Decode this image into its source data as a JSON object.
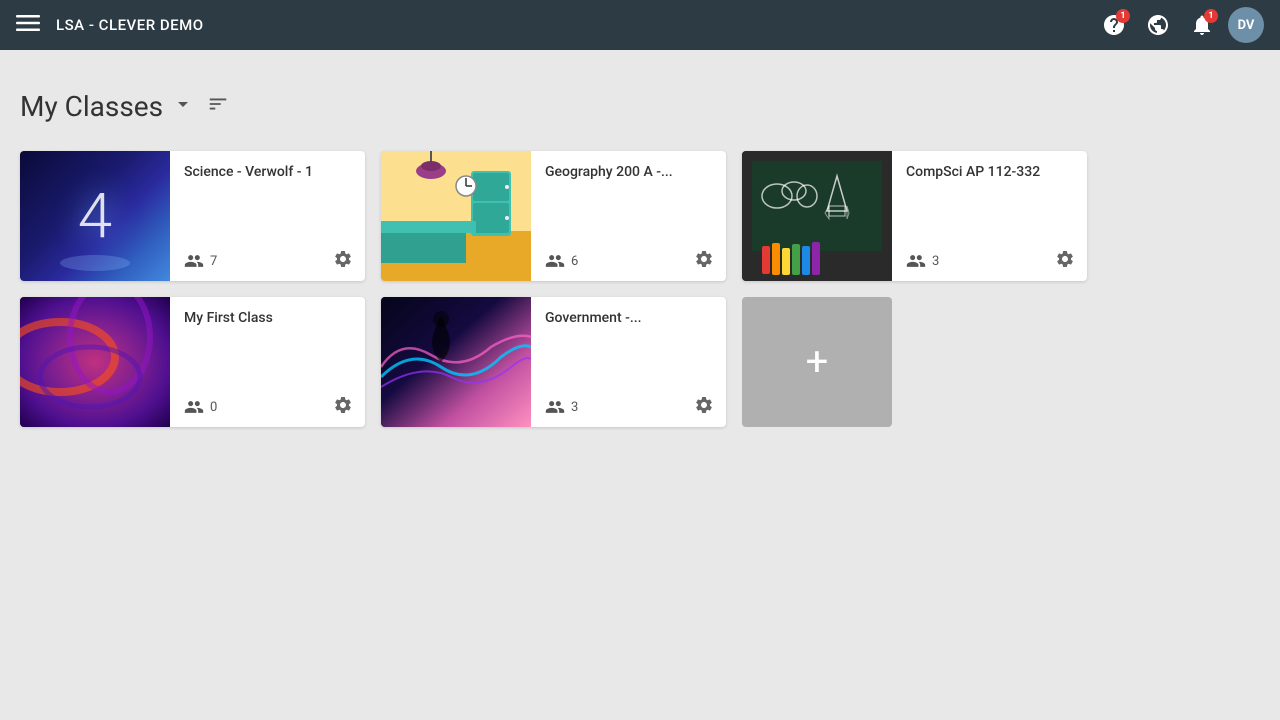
{
  "header": {
    "menu_icon": "☰",
    "title": "LSA - CLEVER DEMO",
    "help_badge": "1",
    "notif_badge": "1",
    "avatar_initials": "DV"
  },
  "page": {
    "title": "My Classes",
    "filter_label": "filter"
  },
  "classes": [
    {
      "id": "science",
      "name": "Science - Verwolf - 1",
      "student_count": "7",
      "image_type": "science",
      "image_label": "4"
    },
    {
      "id": "geography",
      "name": "Geography 200 A -...",
      "student_count": "6",
      "image_type": "geography",
      "image_label": ""
    },
    {
      "id": "compsci",
      "name": "CompSci AP 112-332",
      "student_count": "3",
      "image_type": "compsci",
      "image_label": ""
    },
    {
      "id": "firstclass",
      "name": "My First Class",
      "student_count": "0",
      "image_type": "firstclass",
      "image_label": ""
    },
    {
      "id": "government",
      "name": "Government -...",
      "student_count": "3",
      "image_type": "government",
      "image_label": ""
    }
  ],
  "add_class": {
    "label": "+"
  }
}
